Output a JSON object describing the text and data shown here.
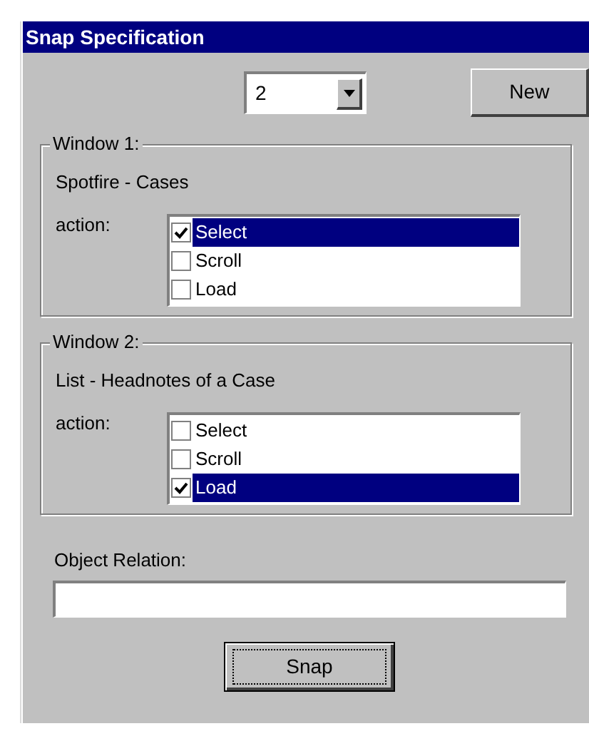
{
  "window": {
    "title": "Snap Specification"
  },
  "selector": {
    "value": "2"
  },
  "new_button": "New",
  "groups": [
    {
      "label": "Window 1:",
      "name": "Spotfire - Cases",
      "action_label": "action:",
      "actions": [
        {
          "label": "Select",
          "checked": true,
          "selected": true
        },
        {
          "label": "Scroll",
          "checked": false,
          "selected": false
        },
        {
          "label": "Load",
          "checked": false,
          "selected": false
        }
      ]
    },
    {
      "label": "Window 2:",
      "name": "List - Headnotes of a Case",
      "action_label": "action:",
      "actions": [
        {
          "label": "Select",
          "checked": false,
          "selected": false
        },
        {
          "label": "Scroll",
          "checked": false,
          "selected": false
        },
        {
          "label": "Load",
          "checked": true,
          "selected": true
        }
      ]
    }
  ],
  "object_relation": {
    "label": "Object Relation:"
  },
  "snap_button": "Snap"
}
